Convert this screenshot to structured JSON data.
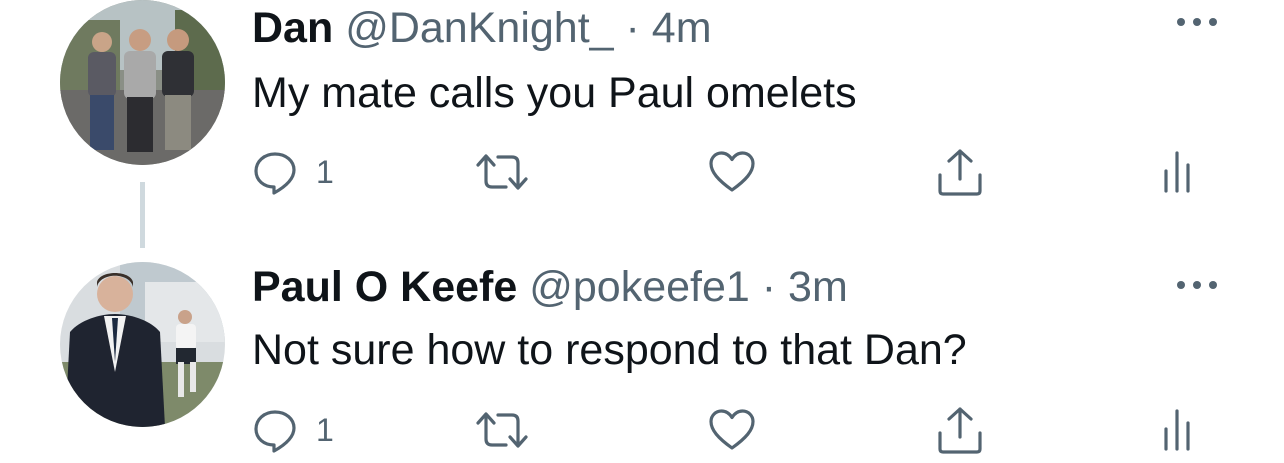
{
  "tweets": [
    {
      "name": "Dan",
      "handle": "@DanKnight_",
      "separator": "·",
      "time": "4m",
      "text": "My mate calls you Paul omelets",
      "reply_count": "1",
      "avatar_icon": "avatar-photo-group"
    },
    {
      "name": "Paul O Keefe",
      "handle": "@pokeefe1",
      "separator": "·",
      "time": "3m",
      "text": "Not sure how to respond to that Dan?",
      "reply_count": "1",
      "avatar_icon": "avatar-photo-portrait"
    }
  ],
  "colors": {
    "text_primary": "#0f1419",
    "text_secondary": "#536471",
    "icon": "#536471",
    "thread_line": "#cfd9de"
  },
  "icons": [
    "reply-icon",
    "retweet-icon",
    "like-icon",
    "share-icon",
    "analytics-icon",
    "more-icon"
  ]
}
